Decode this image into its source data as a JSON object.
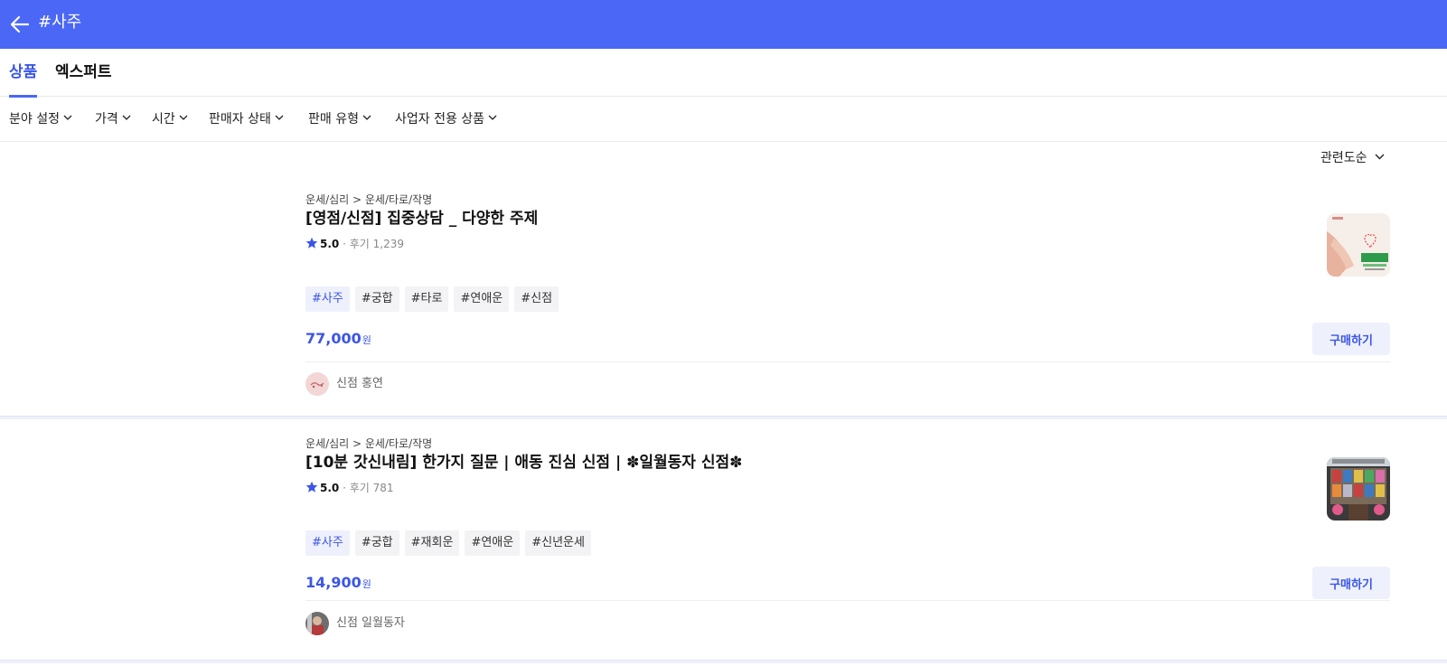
{
  "header": {
    "title": "#사주",
    "back_icon": "arrow-left-icon",
    "background": "#4b67f5"
  },
  "tabs": [
    {
      "label": "상품",
      "active": true
    },
    {
      "label": "엑스퍼트",
      "active": false
    }
  ],
  "filters": [
    {
      "label": "분야 설정"
    },
    {
      "label": "가격"
    },
    {
      "label": "시간"
    },
    {
      "label": "판매자 상태"
    },
    {
      "label": "판매 유형"
    },
    {
      "label": "사업자 전용 상품"
    }
  ],
  "sort": {
    "label": "관련도순"
  },
  "products": [
    {
      "breadcrumb": "운세/심리 > 운세/타로/작명",
      "title": "[영점/신점] 집중상담 _ 다양한 주제",
      "rating": "5.0",
      "review_text": "· 후기 1,239",
      "tags": [
        "#사주",
        "#궁합",
        "#타로",
        "#연애운",
        "#신점"
      ],
      "price": "77,000",
      "price_unit": "원",
      "buy_label": "구매하기",
      "seller": "신점 홍연"
    },
    {
      "breadcrumb": "운세/심리 > 운세/타로/작명",
      "title": "[10분 갓신내림] 한가지 질문 | 애동 진심 신점 | ✽일월동자 신점✽",
      "rating": "5.0",
      "review_text": "· 후기 781",
      "tags": [
        "#사주",
        "#궁합",
        "#재회운",
        "#연애운",
        "#신년운세"
      ],
      "price": "14,900",
      "price_unit": "원",
      "buy_label": "구매하기",
      "seller": "신점 일월동자"
    }
  ],
  "colors": {
    "accent": "#3b56e6",
    "tag_highlight_bg": "#eef1fc",
    "star": "#3b56e6"
  }
}
